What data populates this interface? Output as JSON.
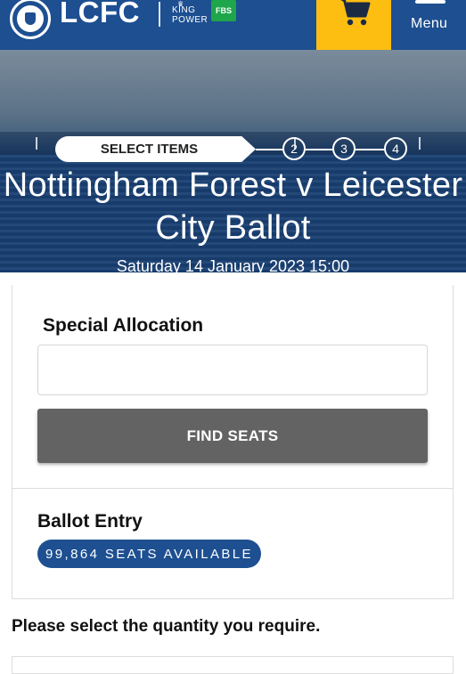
{
  "header": {
    "logo_text": "LCFC",
    "sponsor_line1": "KING",
    "sponsor_line2": "POWER",
    "sponsor_badge": "FBS",
    "menu_label": "Menu",
    "cart_icon": "shopping-cart-icon",
    "colors": {
      "brand_blue": "#1d4f91",
      "cart_yellow": "#fdbe11",
      "fbs_green": "#1fa64a"
    }
  },
  "progress": {
    "current_step_label": "SELECT ITEMS",
    "steps": [
      "2",
      "3",
      "4"
    ]
  },
  "event": {
    "title": "Nottingham Forest v Leicester City Ballot",
    "date": "Saturday 14 January 2023 15:00"
  },
  "special_allocation": {
    "label": "Special Allocation",
    "input_value": "",
    "button_label": "FIND SEATS"
  },
  "ballot": {
    "title": "Ballot Entry",
    "seats_available": "99,864 SEATS AVAILABLE"
  },
  "quantity": {
    "prompt": "Please select the quantity you require."
  }
}
